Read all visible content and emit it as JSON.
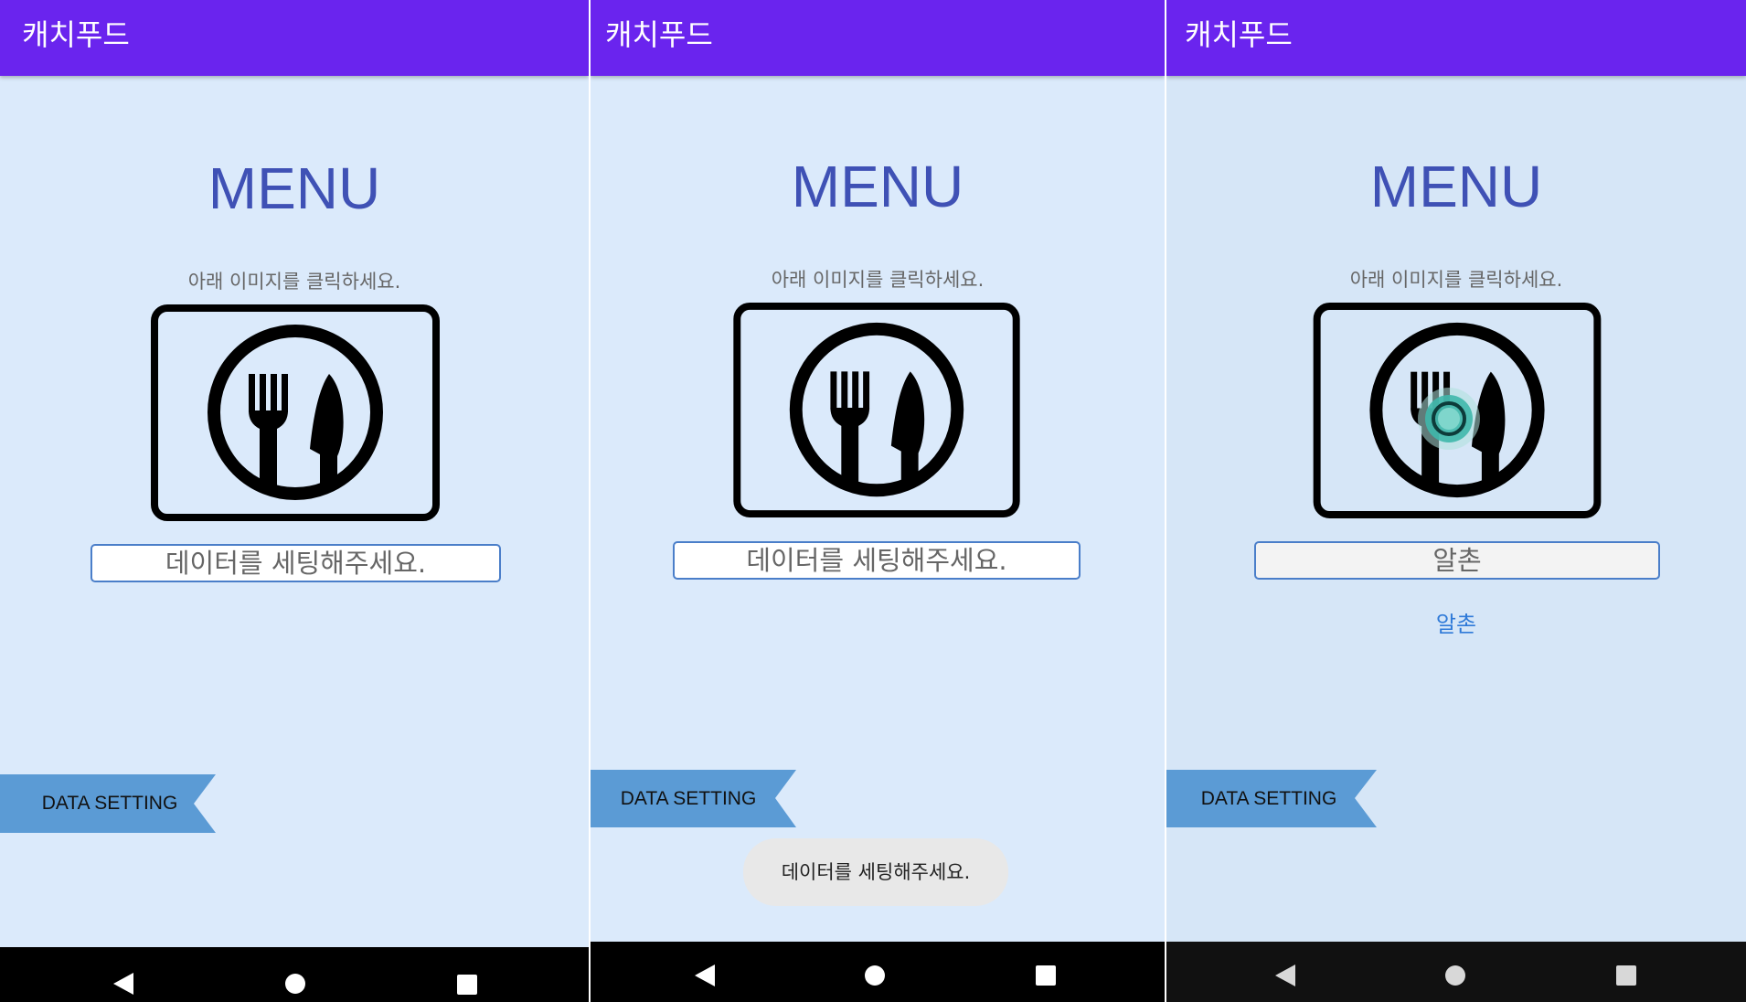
{
  "colors": {
    "app_bar": "#6a24ee",
    "background": "#dbeafb",
    "menu_title": "#3f51b5",
    "ribbon": "#5b9bd5",
    "link": "#2f7ad8",
    "nav_bar": "#000000"
  },
  "screens": [
    {
      "app_title": "캐치푸드",
      "menu_title": "MENU",
      "instruction": "아래 이미지를 클릭하세요.",
      "image_icon": "fork-knife-plate-icon",
      "result_text": "데이터를 세팅해주세요.",
      "data_setting_label": "DATA SETTING",
      "nav": {
        "back": "back-icon",
        "home": "home-icon",
        "recents": "recents-icon"
      }
    },
    {
      "app_title": "캐치푸드",
      "menu_title": "MENU",
      "instruction": "아래 이미지를 클릭하세요.",
      "image_icon": "fork-knife-plate-icon",
      "result_text": "데이터를 세팅해주세요.",
      "data_setting_label": "DATA SETTING",
      "toast": "데이터를 세팅해주세요.",
      "nav": {
        "back": "back-icon",
        "home": "home-icon",
        "recents": "recents-icon"
      }
    },
    {
      "app_title": "캐치푸드",
      "menu_title": "MENU",
      "instruction": "아래 이미지를 클릭하세요.",
      "image_icon": "fork-knife-plate-icon",
      "result_text": "알촌",
      "result_link": "알촌",
      "data_setting_label": "DATA SETTING",
      "nav": {
        "back": "back-icon",
        "home": "home-icon",
        "recents": "recents-icon"
      }
    }
  ]
}
